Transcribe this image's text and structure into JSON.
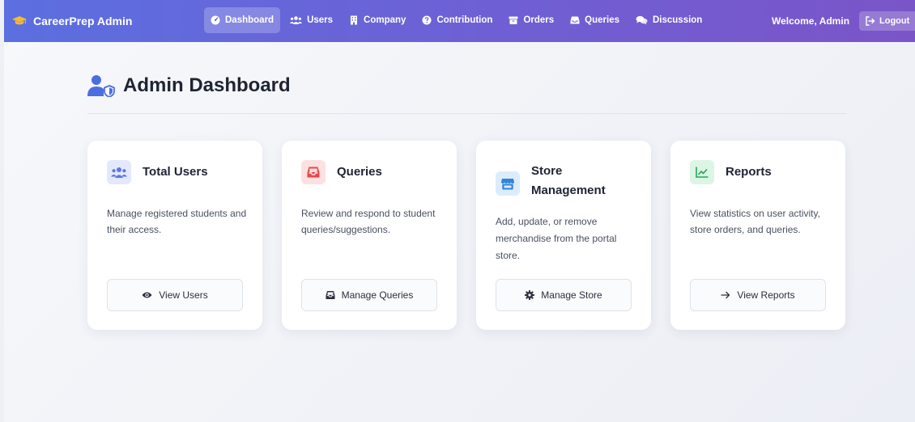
{
  "brand": {
    "name": "CareerPrep Admin",
    "icon": "graduation-cap-icon"
  },
  "nav": [
    {
      "label": "Dashboard",
      "icon": "gauge-icon",
      "active": true
    },
    {
      "label": "Users",
      "icon": "users-icon",
      "active": false
    },
    {
      "label": "Company",
      "icon": "building-icon",
      "active": false
    },
    {
      "label": "Contribution",
      "icon": "question-circle-icon",
      "active": false
    },
    {
      "label": "Orders",
      "icon": "box-icon",
      "active": false
    },
    {
      "label": "Queries",
      "icon": "inbox-icon",
      "active": false
    },
    {
      "label": "Discussion",
      "icon": "comments-icon",
      "active": false
    }
  ],
  "user": {
    "welcome": "Welcome, Admin",
    "logout_label": "Logout"
  },
  "page": {
    "title": "Admin Dashboard",
    "icon": "user-shield-icon"
  },
  "cards": [
    {
      "title": "Total Users",
      "description": "Manage registered students and their access.",
      "button": "View Users",
      "icon": "users-icon",
      "button_icon": "eye-icon"
    },
    {
      "title": "Queries",
      "description": "Review and respond to student queries/suggestions.",
      "button": "Manage Queries",
      "icon": "inbox-icon",
      "button_icon": "inbox-icon"
    },
    {
      "title": "Store Management",
      "description": "Add, update, or remove merchandise from the portal store.",
      "button": "Manage Store",
      "icon": "store-icon",
      "button_icon": "gear-icon"
    },
    {
      "title": "Reports",
      "description": "View statistics on user activity, store orders, and queries.",
      "button": "View Reports",
      "icon": "chart-line-icon",
      "button_icon": "arrow-right-icon"
    }
  ],
  "colors": {
    "nav_start": "#5b6fe0",
    "nav_end": "#7a55c8",
    "users_tint": "#e3e8fb",
    "queries_tint": "#fde0e0",
    "store_tint": "#dcecfb",
    "reports_tint": "#dcf5e4"
  }
}
